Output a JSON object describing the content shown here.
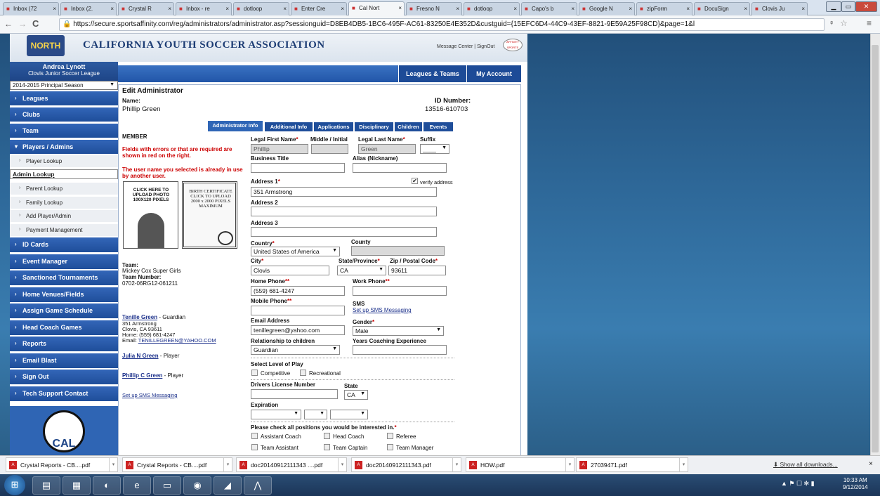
{
  "browser": {
    "tabs": [
      {
        "label": "Inbox (72",
        "icon": "gmail-icon"
      },
      {
        "label": "Inbox (2.",
        "icon": "gmail-icon"
      },
      {
        "label": "Crystal R",
        "icon": "doc-icon"
      },
      {
        "label": "Inbox - re",
        "icon": "gmail-icon"
      },
      {
        "label": "dotloop",
        "icon": "dotloop-icon"
      },
      {
        "label": "Enter Cre",
        "icon": "doc-icon"
      },
      {
        "label": "Cal Nort",
        "icon": "affinity-icon"
      },
      {
        "label": "Fresno N",
        "icon": "site-icon"
      },
      {
        "label": "dotloop",
        "icon": "dotloop-icon"
      },
      {
        "label": "Capo's b",
        "icon": "site-icon"
      },
      {
        "label": "Google N",
        "icon": "google-icon"
      },
      {
        "label": "zipForm",
        "icon": "site-icon"
      },
      {
        "label": "DocuSign",
        "icon": "docusign-icon"
      },
      {
        "label": "Clovis Ju",
        "icon": "facebook-icon"
      }
    ],
    "url": "https://secure.sportsaffinity.com/reg/administrators/administrator.asp?sessionguid=D8EB4DB5-1BC6-495F-AC61-83250E4E352D&custguid={15EFC6D4-44C9-43EF-8821-9E59A25F98CD}&page=1&l"
  },
  "banner": {
    "title": "CALIFORNIA YOUTH SOCCER ASSOCIATION",
    "logo_text": "NORTH",
    "links": "Message Center | SignOut",
    "affinity": "AFFINITY SPORTS"
  },
  "sidebar": {
    "user_name": "Andrea Lynott",
    "org": "Clovis Junior Soccer League",
    "season": "2014-2015 Principal Season",
    "nav_top": [
      "Leagues",
      "Clubs",
      "Team",
      "Players / Admins"
    ],
    "sub_items": [
      "Player Lookup",
      "Admin Lookup",
      "Parent Lookup",
      "Family Lookup",
      "Add Player/Admin",
      "Payment Management"
    ],
    "nav_bottom": [
      "ID Cards",
      "Event Manager",
      "Sanctioned Tournaments",
      "Home Venues/Fields",
      "Assign Game Schedule",
      "Head Coach Games",
      "Reports",
      "Email Blast",
      "Sign Out",
      "Tech Support Contact"
    ],
    "logo_text": "CAL"
  },
  "topnav": {
    "leagues_teams": "Leagues & Teams",
    "my_account": "My Account"
  },
  "main": {
    "heading": "Edit Administrator",
    "name_label": "Name:",
    "name_value": "Phillip Green",
    "id_label": "ID Number:",
    "id_value": "13516-610703",
    "tabs": [
      "Administrator Info",
      "Additional Info",
      "Applications",
      "Disciplinary",
      "Children",
      "Events"
    ],
    "member_label": "MEMBER",
    "error1": "Fields with errors or that are required are shown in red on the right.",
    "error2": "The user name you selected is already in use by another user.",
    "upload_photo": "CLICK HERE TO UPLOAD PHOTO 100X120 PIXELS",
    "birth_cert": "BIRTH CERTIFICATE CLICK TO UPLOAD 2000 x 2000 PIXELS MAXIMUM",
    "team_label": "Team:",
    "team_value": "Mickey Cox Super Girls",
    "team_number_label": "Team Number:",
    "team_number_value": "0702-06RG12-061211",
    "guardian_name": "Tenille Green",
    "guardian_role": " - Guardian",
    "guardian_addr1": "351 Armstrong",
    "guardian_addr2": "Clovis, CA 93611",
    "guardian_home": "Home: (559) 681-4247",
    "guardian_email_prefix": "Email: ",
    "guardian_email": "TENILLEGREEN@YAHOO.COM",
    "child1_name": "Julia N Green",
    "child1_role": " - Player",
    "child2_name": "Phillip C Green",
    "child2_role": " - Player",
    "sms_link": "Set up SMS Messaging"
  },
  "form": {
    "first_name_label": "Legal First Name",
    "first_name": "Phillip",
    "middle_label": "Middle / Initial",
    "middle": "",
    "last_name_label": "Legal Last Name",
    "last_name": "Green",
    "suffix_label": "Suffix",
    "suffix": "____",
    "business_title_label": "Business Title",
    "alias_label": "Alias (Nickname)",
    "address1_label": "Address 1",
    "verify_label": "verify address",
    "address1": "351 Armstrong",
    "address2_label": "Address 2",
    "address3_label": "Address 3",
    "country_label": "Country",
    "country": "United States of America",
    "county_label": "County",
    "city_label": "City",
    "city": "Clovis",
    "state_label": "State/Province",
    "state": "CA",
    "zip_label": "Zip / Postal Code",
    "zip": "93611",
    "home_phone_label": "Home Phone",
    "home_phone": "(559) 681-4247",
    "work_phone_label": "Work Phone",
    "mobile_label": "Mobile Phone",
    "sms_label": "SMS",
    "sms_link": "Set up SMS Messaging",
    "email_label": "Email Address",
    "email": "tenillegreen@yahoo.com",
    "gender_label": "Gender",
    "gender": "Male",
    "relationship_label": "Relationship to children",
    "relationship": "Guardian",
    "years_label": "Years Coaching Experience",
    "level_label": "Select Level of Play",
    "competitive": "Competitive",
    "recreational": "Recreational",
    "dl_label": "Drivers License Number",
    "dl_state_label": "State",
    "dl_state": "CA",
    "expiration_label": "Expiration",
    "positions_label": "Please check all positions you would be interested in.",
    "positions": [
      "Assistant Coach",
      "Head Coach",
      "Referee",
      "Team Assistant",
      "Team Captain",
      "Team Manager"
    ]
  },
  "downloads": {
    "items": [
      "Crystal Reports - CB....pdf",
      "Crystal Reports - CB....pdf",
      "doc20140912111343 ....pdf",
      "doc20140912111343.pdf",
      "HOW.pdf",
      "27039471.pdf"
    ],
    "show_all": "Show all downloads...",
    "close": "×"
  },
  "taskbar": {
    "time": "10:33 AM",
    "date": "9/12/2014",
    "apps": [
      "windows-explorer-icon",
      "excel-icon",
      "outlook-icon",
      "ie-icon",
      "folder-icon",
      "chrome-icon",
      "remote-icon",
      "acrobat-icon"
    ]
  }
}
